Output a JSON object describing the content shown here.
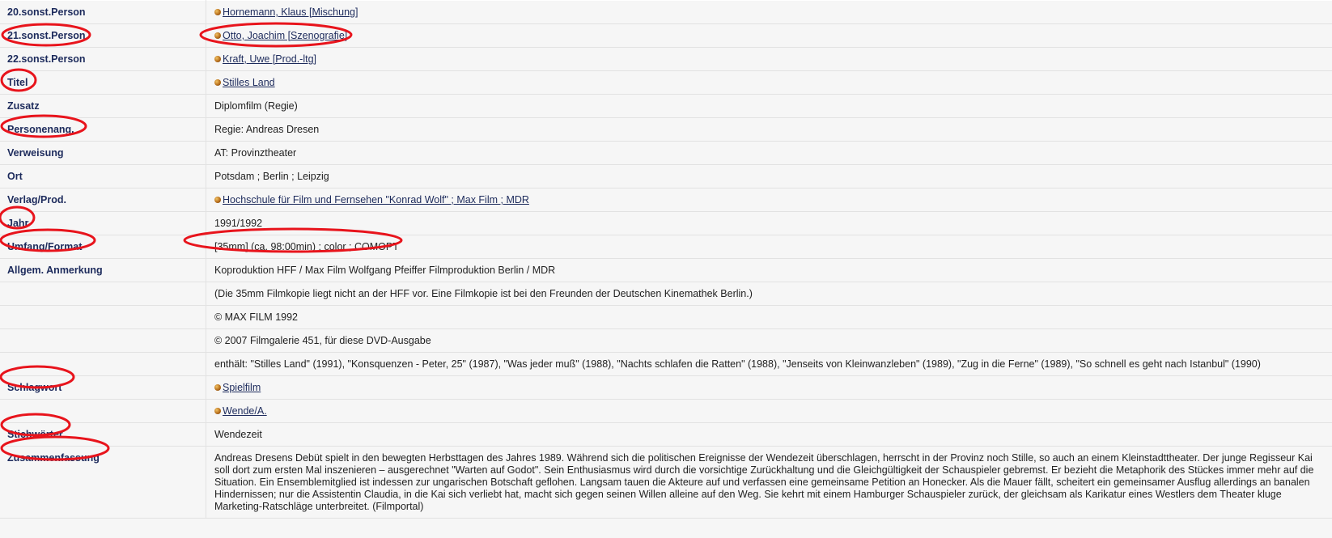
{
  "rows": [
    {
      "label": "20.sonst.Person",
      "value": "Hornemann, Klaus [Mischung]",
      "link": true
    },
    {
      "label": "21.sonst.Person",
      "value": "Otto, Joachim [Szenografie]",
      "link": true
    },
    {
      "label": "22.sonst.Person",
      "value": "Kraft, Uwe [Prod.-ltg]",
      "link": true
    },
    {
      "label": "Titel",
      "value": "Stilles Land",
      "link": true
    },
    {
      "label": "Zusatz",
      "value": "Diplomfilm (Regie)",
      "link": false
    },
    {
      "label": "Personenang.",
      "value": "Regie: Andreas Dresen",
      "link": false
    },
    {
      "label": "Verweisung",
      "value": "AT: Provinztheater",
      "link": false
    },
    {
      "label": "Ort",
      "value": "Potsdam ; Berlin ; Leipzig",
      "link": false
    },
    {
      "label": "Verlag/Prod.",
      "value": "Hochschule für Film und Fernsehen \"Konrad Wolf\" ; Max Film ; MDR",
      "link": true
    },
    {
      "label": "Jahr",
      "value": "1991/1992",
      "link": false
    },
    {
      "label": "Umfang/Format",
      "value": "[35mm] (ca. 98:00min) ; color ; COMOPT",
      "link": false
    },
    {
      "label": "Allgem. Anmerkung",
      "value": "Koproduktion HFF / Max Film Wolfgang Pfeiffer Filmproduktion Berlin / MDR",
      "link": false
    },
    {
      "label": "",
      "value": "(Die 35mm Filmkopie liegt nicht an der HFF vor. Eine Filmkopie ist bei den Freunden der Deutschen Kinemathek Berlin.)",
      "link": false
    },
    {
      "label": "",
      "value": "© MAX FILM 1992",
      "link": false
    },
    {
      "label": "",
      "value": "© 2007 Filmgalerie 451, für diese DVD-Ausgabe",
      "link": false
    },
    {
      "label": "",
      "value": "enthält: \"Stilles Land\" (1991), \"Konsquenzen - Peter, 25\" (1987), \"Was jeder muß\" (1988), \"Nachts schlafen die Ratten\" (1988), \"Jenseits von Kleinwanzleben\" (1989), \"Zug in die Ferne\" (1989), \"So schnell es geht nach Istanbul\" (1990)",
      "link": false
    },
    {
      "label": "Schlagwort",
      "value": "Spielfilm",
      "link": true
    },
    {
      "label": "",
      "value": "Wende/A.",
      "link": true
    },
    {
      "label": "Stichwörter",
      "value": "Wendezeit",
      "link": false
    },
    {
      "label": "Zusammenfassung",
      "value": "Andreas Dresens Debüt spielt in den bewegten Herbsttagen des Jahres 1989. Während sich die politischen Ereignisse der Wendezeit überschlagen, herrscht in der Provinz noch Stille, so auch an einem Kleinstadttheater. Der junge Regisseur Kai soll dort zum ersten Mal inszenieren – ausgerechnet \"Warten auf Godot\". Sein Enthusiasmus wird durch die vorsichtige Zurückhaltung und die Gleichgültigkeit der Schauspieler gebremst. Er bezieht die Metaphorik des Stückes immer mehr auf die Situation. Ein Ensemblemitglied ist indessen zur ungarischen Botschaft geflohen. Langsam tauen die Akteure auf und verfassen eine gemeinsame Petition an Honecker. Als die Mauer fällt, scheitert ein gemeinsamer Ausflug allerdings an banalen Hindernissen; nur die Assistentin Claudia, in die Kai sich verliebt hat, macht sich gegen seinen Willen alleine auf den Weg. Sie kehrt mit einem Hamburger Schauspieler zurück, der gleichsam als Karikatur eines Westlers dem Theater kluge Marketing-Ratschläge unterbreitet. (Filmportal)",
      "link": false
    }
  ],
  "highlight_color": "#e8141c",
  "link_color": "#1d2b5c",
  "bullet_icon": "orange-bullet-icon"
}
